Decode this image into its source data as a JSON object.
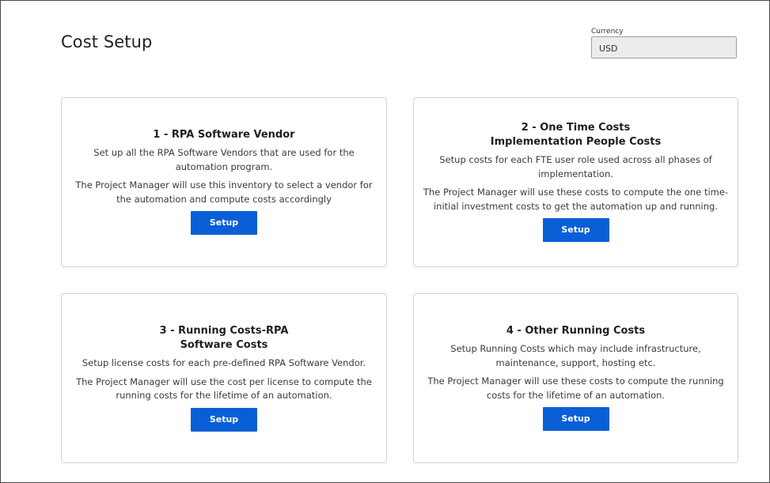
{
  "page": {
    "title": "Cost Setup"
  },
  "currency": {
    "label": "Currency",
    "value": "USD"
  },
  "cards": [
    {
      "title_lines": [
        "1 - RPA Software Vendor"
      ],
      "paragraphs": [
        [
          "Set up all the RPA Software Vendors that are used for the",
          "automation program."
        ],
        [
          "The Project Manager will use this inventory to select a vendor for",
          "the automation and compute costs accordingly"
        ]
      ],
      "button_label": "Setup"
    },
    {
      "title_lines": [
        "2 - One Time Costs",
        "Implementation People Costs"
      ],
      "paragraphs": [
        [
          "Setup costs for each FTE user role used across all phases of",
          "implementation."
        ],
        [
          "The Project Manager will use these costs to compute the one time-",
          "initial investment costs to get the automation up and running."
        ]
      ],
      "button_label": "Setup"
    },
    {
      "title_lines": [
        "3 - Running Costs-RPA",
        "Software Costs"
      ],
      "paragraphs": [
        [
          "Setup license costs for each pre-defined RPA Software Vendor."
        ],
        [
          "The Project Manager will use the cost per license to compute the",
          "running costs for the lifetime of an automation."
        ]
      ],
      "button_label": "Setup"
    },
    {
      "title_lines": [
        "4 - Other Running Costs"
      ],
      "paragraphs": [
        [
          "Setup Running Costs which may include infrastructure,",
          "maintenance, support, hosting etc."
        ],
        [
          "The Project Manager will use these costs to compute the running",
          "costs for the lifetime of an automation."
        ]
      ],
      "button_label": "Setup"
    }
  ],
  "theme": {
    "button_color": "#0a5fd7",
    "card_border": "#d3d3d3",
    "field_background": "#eaeced"
  }
}
